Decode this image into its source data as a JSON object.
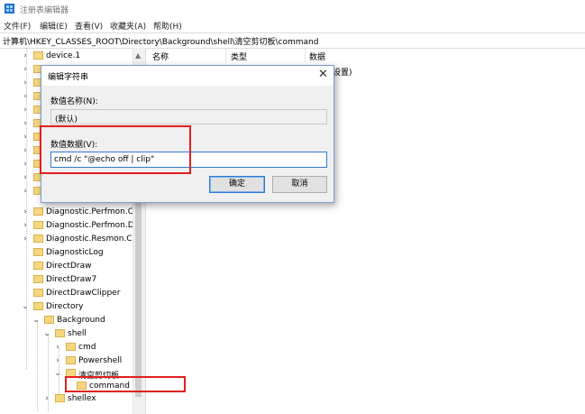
{
  "window": {
    "title": "注册表编辑器"
  },
  "menu": [
    "文件(F)",
    "编辑(E)",
    "查看(V)",
    "收藏夹(A)",
    "帮助(H)"
  ],
  "address": "计算机\\HKEY_CLASSES_ROOT\\Directory\\Background\\shell\\清空剪切板\\command",
  "tree": {
    "items": [
      {
        "label": "device.1",
        "expanded": false
      },
      {
        "label": "Diagnostic.Perfmon.Co",
        "expanded": false
      },
      {
        "label": "Diagnostic.Perfmon.Dc",
        "expanded": false
      },
      {
        "label": "Diagnostic.Resmon.Co",
        "expanded": false
      },
      {
        "label": "DiagnosticLog",
        "expanded": false
      },
      {
        "label": "DirectDraw",
        "expanded": false
      },
      {
        "label": "DirectDraw7",
        "expanded": false
      },
      {
        "label": "DirectDrawClipper",
        "expanded": false
      },
      {
        "label": "Directory",
        "expanded": true
      },
      {
        "label": "Background",
        "expanded": true
      },
      {
        "label": "shell",
        "expanded": true
      },
      {
        "label": "cmd",
        "expanded": false
      },
      {
        "label": "Powershell",
        "expanded": false
      },
      {
        "label": "清空剪切板",
        "expanded": true
      },
      {
        "label": "command",
        "expanded": false,
        "selected": true
      },
      {
        "label": "shellex",
        "expanded": false
      }
    ]
  },
  "list": {
    "columns": [
      "名称",
      "类型",
      "数据"
    ],
    "partial_value": "设置)"
  },
  "dialog": {
    "title": "编辑字符串",
    "name_label": "数值名称(N):",
    "name_value": "(默认)",
    "data_label": "数值数据(V):",
    "data_value": "cmd /c \"@echo off | clip\"",
    "ok_label": "确定",
    "cancel_label": "取消",
    "close_glyph": "✕"
  },
  "colors": {
    "highlight": "#e0201e",
    "accent": "#2e7bd6",
    "folder": "#f6d77e"
  }
}
